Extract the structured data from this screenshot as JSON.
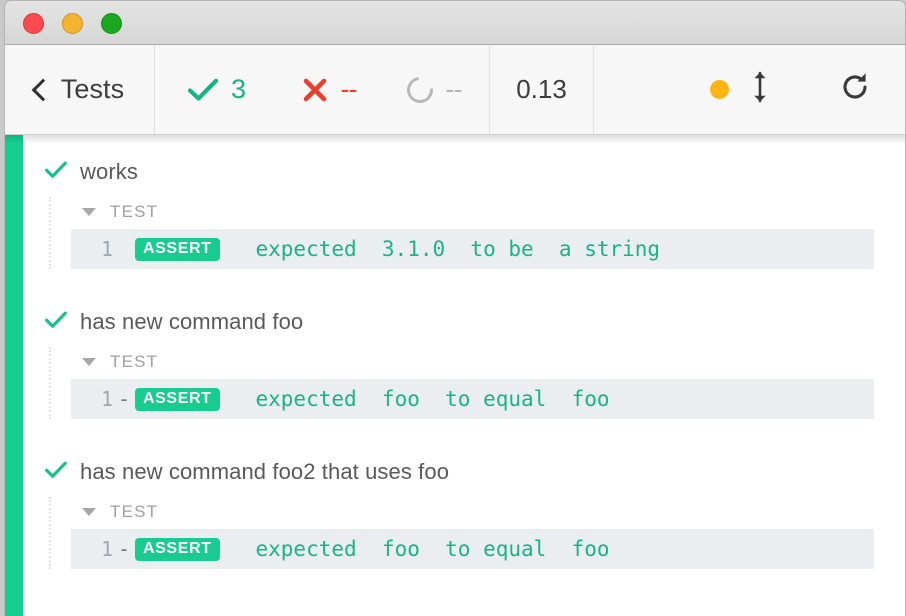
{
  "window": {
    "traffic_lights": [
      {
        "name": "close",
        "color": "#fb4a50"
      },
      {
        "name": "minimize",
        "color": "#f2b432"
      },
      {
        "name": "zoom",
        "color": "#1aa81f"
      }
    ]
  },
  "toolbar": {
    "back_label": "Tests",
    "back_icon": "chevron-left-icon",
    "stats": {
      "passed": {
        "icon": "check-icon",
        "value": "3",
        "color": "#14b57f"
      },
      "failed": {
        "icon": "cross-icon",
        "value": "--",
        "color": "#eb3f2c"
      },
      "pending": {
        "icon": "circle-ring-icon",
        "value": "--",
        "color": "#b4b4b4"
      }
    },
    "duration": "0.13",
    "controls": [
      {
        "name": "status-dot",
        "icon": "orange-dot-icon",
        "color": "#ffb511"
      },
      {
        "name": "expand-collapse",
        "icon": "up-down-arrow-icon"
      },
      {
        "name": "rerun",
        "icon": "reload-icon"
      }
    ]
  },
  "runner": {
    "status_bar_color": "#15cf91",
    "tests": [
      {
        "status_icon": "check-icon",
        "title": "works",
        "group_caret": "caret-down-icon",
        "group_label": "TEST",
        "commands": [
          {
            "number": "1",
            "dash": "",
            "tag": "ASSERT",
            "message": "expected  3.1.0  to be  a string"
          }
        ]
      },
      {
        "status_icon": "check-icon",
        "title": "has new command foo",
        "group_caret": "caret-down-icon",
        "group_label": "TEST",
        "commands": [
          {
            "number": "1",
            "dash": "-",
            "tag": "ASSERT",
            "message": "expected  foo  to equal  foo"
          }
        ]
      },
      {
        "status_icon": "check-icon",
        "title": "has new command foo2 that uses foo",
        "group_caret": "caret-down-icon",
        "group_label": "TEST",
        "commands": [
          {
            "number": "1",
            "dash": "-",
            "tag": "ASSERT",
            "message": "expected  foo  to equal  foo"
          }
        ]
      }
    ]
  }
}
